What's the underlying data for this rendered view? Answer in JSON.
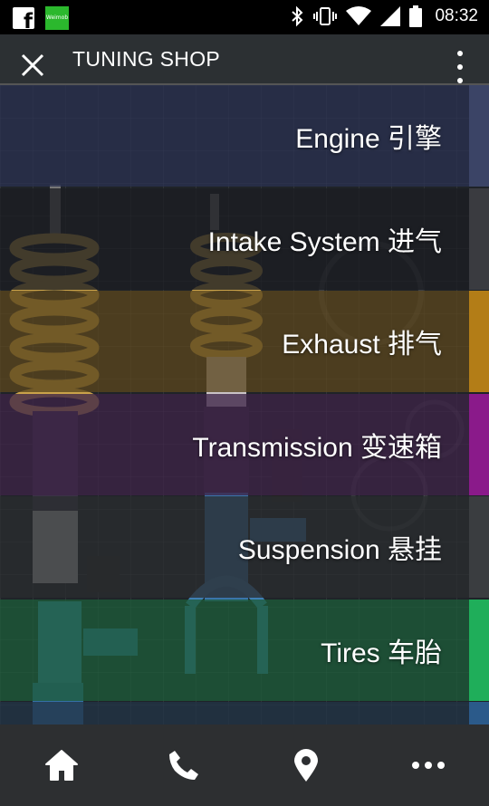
{
  "status_bar": {
    "notification_icons": [
      "facebook-icon",
      "app-notification-icon"
    ],
    "app_badge_text": "Weimob",
    "system_icons": [
      "bluetooth-icon",
      "vibrate-icon",
      "wifi-icon",
      "signal-icon",
      "battery-icon"
    ],
    "time": "08:32"
  },
  "toolbar": {
    "title": "TUNING SHOP",
    "close_icon": "close-icon",
    "menu_icon": "more-vertical-icon"
  },
  "categories": [
    {
      "label": "Engine 引擎",
      "tint": "#2a3150",
      "edge": "#3b4466"
    },
    {
      "label": "Intake System 进气",
      "tint": "#1c1d22",
      "edge": "#3a3b40"
    },
    {
      "label": "Exhaust 排气",
      "tint": "#5a451e",
      "edge": "#b37d17"
    },
    {
      "label": "Transmission 变速箱",
      "tint": "#3e2447",
      "edge": "#8a1a8a"
    },
    {
      "label": "Suspension 悬挂",
      "tint": "#2a2d30",
      "edge": "#3a3d40"
    },
    {
      "label": "Tires 车胎",
      "tint": "#1e5b3a",
      "edge": "#1fae5a"
    },
    {
      "label": "",
      "tint": "#233447",
      "edge": "#2b5a8a"
    }
  ],
  "bottom_nav": [
    {
      "name": "home-icon"
    },
    {
      "name": "phone-icon"
    },
    {
      "name": "location-icon"
    },
    {
      "name": "more-horizontal-icon"
    }
  ],
  "colors": {
    "toolbar_bg": "#2c3033",
    "bottom_bar_bg": "#2d2f31",
    "text": "#ffffff"
  }
}
